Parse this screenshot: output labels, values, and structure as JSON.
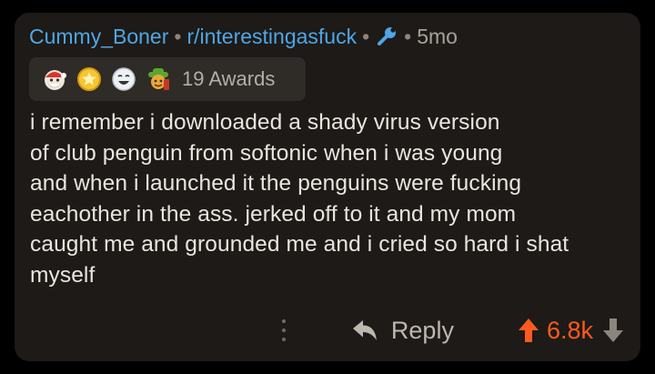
{
  "comment": {
    "author": "Cummy_Boner",
    "separator": "•",
    "subreddit": "r/interestingasfuck",
    "age": "5mo",
    "awards": {
      "icons": [
        "santa-award-icon",
        "gold-medal-award-icon",
        "laughing-face-award-icon",
        "cowboy-award-icon"
      ],
      "count_label": "19 Awards"
    },
    "body_lines": [
      "i remember i downloaded a shady virus version",
      "of club penguin from softonic when i was young",
      "and when i launched it the penguins were fucking",
      "eachother in the ass. jerked off to it and my mom",
      "caught me and grounded me and i cried so hard i shat",
      "myself"
    ],
    "actions": {
      "reply_label": "Reply",
      "score": "6.8k"
    }
  },
  "colors": {
    "background": "#000000",
    "card": "#1d1a17",
    "link_blue": "#4fa6e6",
    "upvote_orange": "#ff5a1f",
    "text": "#e9e5df"
  }
}
